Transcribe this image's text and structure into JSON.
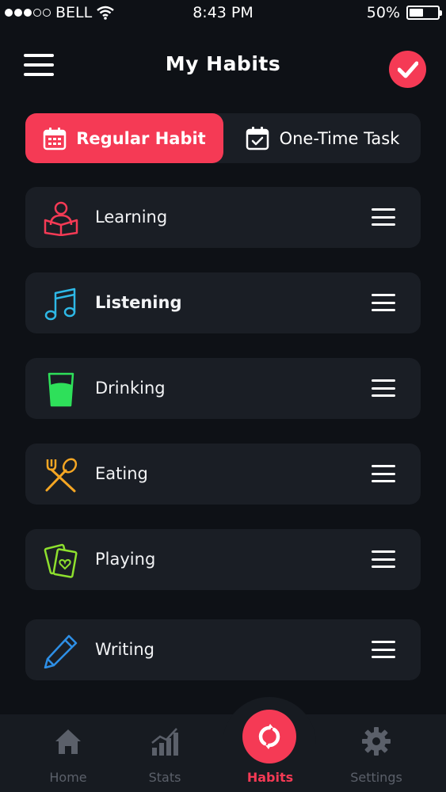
{
  "status_bar": {
    "carrier": "BELL",
    "time": "8:43 PM",
    "battery": "50%",
    "battery_level": 0.5
  },
  "header": {
    "title": "My Habits"
  },
  "tabs": [
    {
      "label": "Regular Habit",
      "icon": "calendar-grid-icon",
      "active": true
    },
    {
      "label": "One-Time Task",
      "icon": "calendar-check-icon",
      "active": false
    }
  ],
  "habits": [
    {
      "label": "Learning",
      "icon": "reading-person-icon",
      "color": "#f53a55"
    },
    {
      "label": "Listening",
      "icon": "music-note-icon",
      "color": "#2eb8e6"
    },
    {
      "label": "Drinking",
      "icon": "glass-icon",
      "color": "#2ee05a"
    },
    {
      "label": "Eating",
      "icon": "fork-spoon-icon",
      "color": "#f5a623"
    },
    {
      "label": "Playing",
      "icon": "cards-icon",
      "color": "#8ee02e"
    },
    {
      "label": "Writing",
      "icon": "pen-icon",
      "color": "#2e8fe6"
    }
  ],
  "nav": [
    {
      "label": "Home",
      "icon": "home-icon"
    },
    {
      "label": "Stats",
      "icon": "bar-chart-icon"
    },
    {
      "label": "Habits",
      "icon": "habits-sync-icon",
      "active": true
    },
    {
      "label": "Settings",
      "icon": "gear-icon"
    }
  ],
  "colors": {
    "accent": "#f53a55",
    "background": "#0e1116",
    "card": "#1a1e25",
    "muted": "#5b606a"
  }
}
